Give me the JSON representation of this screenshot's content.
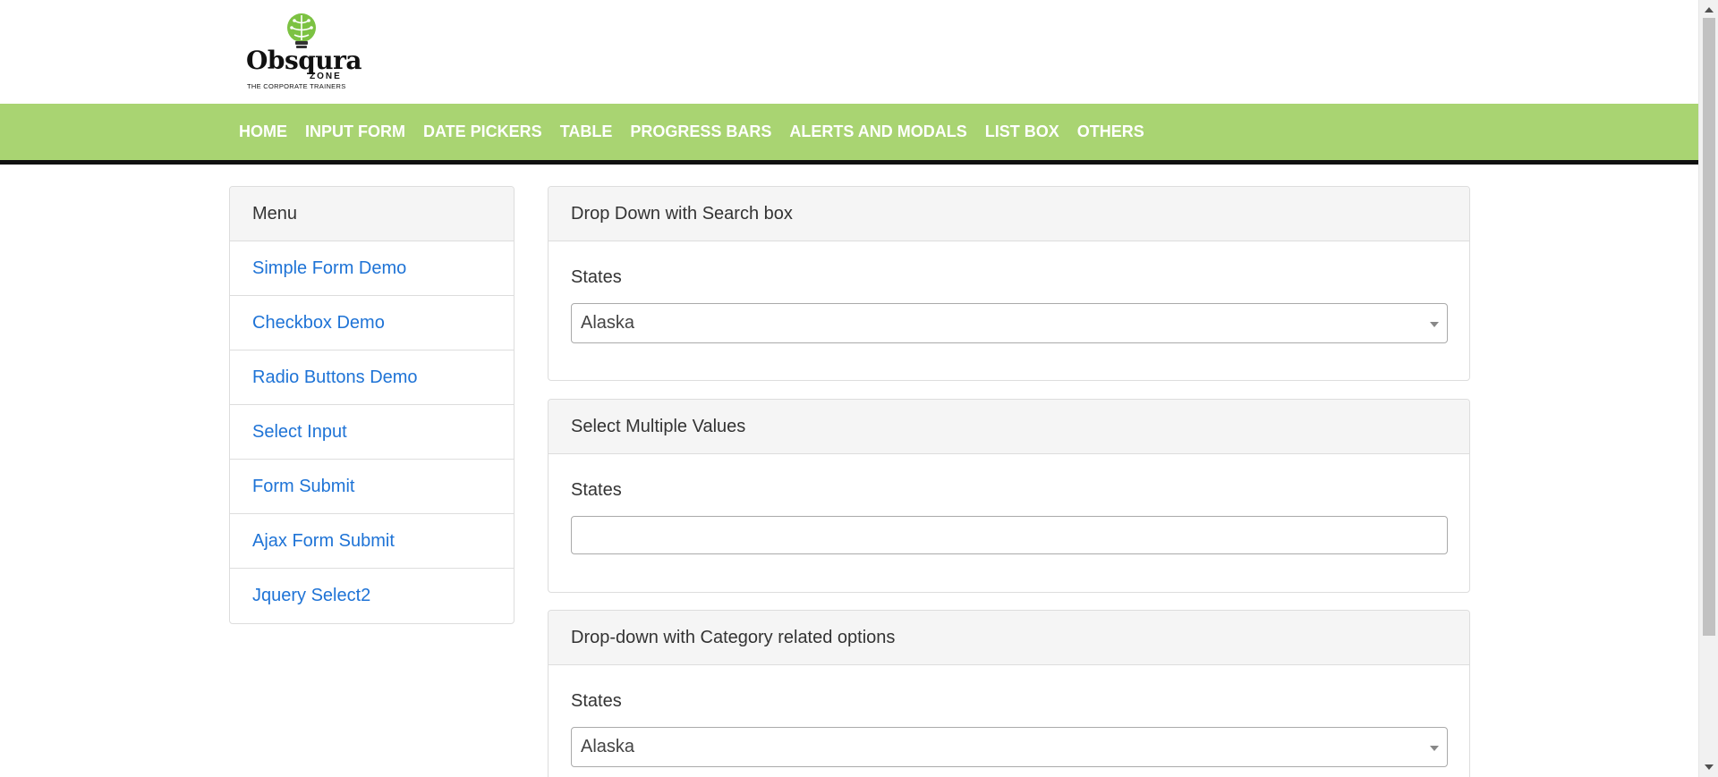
{
  "brand": {
    "logo_word": "Obsqura",
    "logo_zone": "ZONE",
    "tagline": "THE CORPORATE TRAINERS",
    "colors": {
      "bulb": "#7cc242",
      "navbar": "#a9d472",
      "link": "#1e73d6"
    }
  },
  "navbar": {
    "items": [
      {
        "label": "HOME"
      },
      {
        "label": "INPUT FORM"
      },
      {
        "label": "DATE PICKERS"
      },
      {
        "label": "TABLE"
      },
      {
        "label": "PROGRESS BARS"
      },
      {
        "label": "ALERTS AND MODALS"
      },
      {
        "label": "LIST BOX"
      },
      {
        "label": "OTHERS"
      }
    ]
  },
  "menu": {
    "heading": "Menu",
    "items": [
      {
        "label": "Simple Form Demo"
      },
      {
        "label": "Checkbox Demo"
      },
      {
        "label": "Radio Buttons Demo"
      },
      {
        "label": "Select Input"
      },
      {
        "label": "Form Submit"
      },
      {
        "label": "Ajax Form Submit"
      },
      {
        "label": "Jquery Select2"
      }
    ]
  },
  "panels": {
    "search_dropdown": {
      "heading": "Drop Down with Search box",
      "label": "States",
      "selected": "Alaska"
    },
    "multi_select": {
      "heading": "Select Multiple Values",
      "label": "States",
      "value": ""
    },
    "category_dropdown": {
      "heading": "Drop-down with Category related options",
      "label": "States",
      "selected": "Alaska"
    }
  },
  "icons": {
    "logo": "lightbulb-brain-icon",
    "select_arrow": "caret-down-icon",
    "scroll_up": "caret-up-icon",
    "scroll_down": "caret-down-icon"
  }
}
